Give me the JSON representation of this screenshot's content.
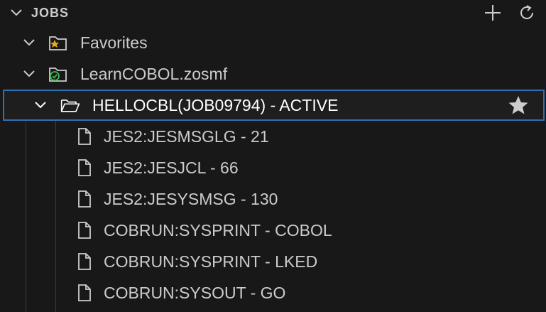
{
  "panel": {
    "title": "JOBS",
    "actions": {
      "add_icon": "plus-icon",
      "refresh_icon": "refresh-icon"
    }
  },
  "tree": {
    "favorites": {
      "label": "Favorites",
      "icon": "folder-star-icon",
      "expanded": true
    },
    "profile": {
      "label": "LearnCOBOL.zosmf",
      "icon": "folder-connected-icon",
      "expanded": true
    },
    "job": {
      "label": "HELLOCBL(JOB09794) - ACTIVE",
      "icon": "folder-open-icon",
      "expanded": true,
      "selected": true,
      "action_icon": "star-icon"
    },
    "spool_files": [
      {
        "label": "JES2:JESMSGLG - 21",
        "icon": "file-icon"
      },
      {
        "label": "JES2:JESJCL - 66",
        "icon": "file-icon"
      },
      {
        "label": "JES2:JESYSMSG - 130",
        "icon": "file-icon"
      },
      {
        "label": "COBRUN:SYSPRINT - COBOL",
        "icon": "file-icon"
      },
      {
        "label": "COBRUN:SYSPRINT - LKED",
        "icon": "file-icon"
      },
      {
        "label": "COBRUN:SYSOUT - GO",
        "icon": "file-icon"
      }
    ]
  },
  "colors": {
    "background": "#181818",
    "text": "#cccccc",
    "selection_border": "#2f6fb5",
    "favorite_star": "#e6a817",
    "connected_check": "#3fb950"
  }
}
